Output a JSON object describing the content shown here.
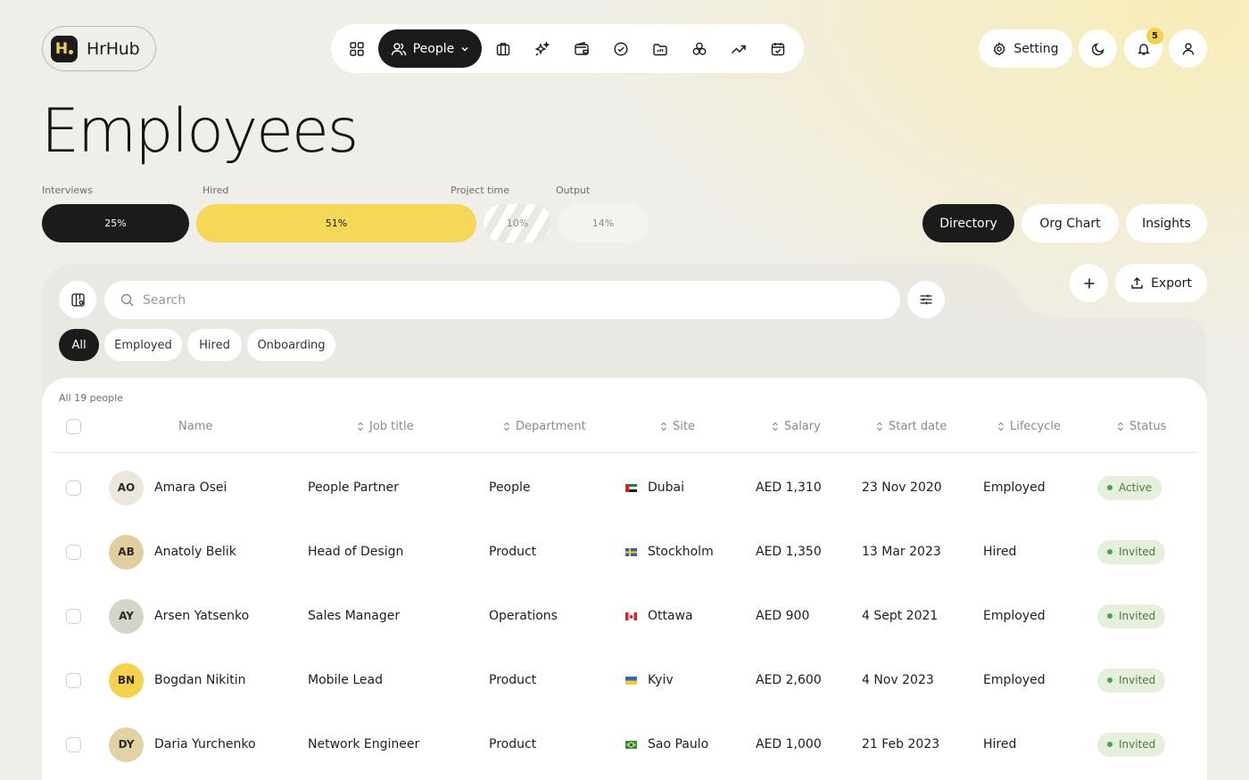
{
  "app": {
    "name": "HrHub",
    "logo_letter": "H"
  },
  "nav": {
    "active_label": "People",
    "icons": [
      "grid-icon",
      "people-icon",
      "briefcase-icon",
      "sparkles-icon",
      "wallet-icon",
      "check-circle-icon",
      "folder-icon",
      "network-icon",
      "trend-icon",
      "calendar-icon"
    ]
  },
  "header": {
    "setting_label": "Setting",
    "notification_count": "5"
  },
  "page": {
    "title": "Employees"
  },
  "metrics": [
    {
      "label": "Interviews",
      "value": "25%"
    },
    {
      "label": "Hired",
      "value": "51%"
    },
    {
      "label": "Project time",
      "value": "10%"
    },
    {
      "label": "Output",
      "value": "14%"
    }
  ],
  "views": [
    "Directory",
    "Org Chart",
    "Insights"
  ],
  "actions": {
    "export_label": "Export"
  },
  "search": {
    "placeholder": "Search"
  },
  "filters": [
    "All",
    "Employed",
    "Hired",
    "Onboarding"
  ],
  "table": {
    "count_label": "All 19 people",
    "columns": [
      "Name",
      "Job title",
      "Department",
      "Site",
      "Salary",
      "Start date",
      "Lifecycle",
      "Status"
    ],
    "rows": [
      {
        "initials": "AO",
        "name": "Amara Osei",
        "job": "People Partner",
        "dept": "People",
        "site": "Dubai",
        "salary": "AED 1,310",
        "start": "23 Nov 2020",
        "lifecycle": "Employed",
        "status": "Active"
      },
      {
        "initials": "AB",
        "name": "Anatoly Belik",
        "job": "Head of Design",
        "dept": "Product",
        "site": "Stockholm",
        "salary": "AED 1,350",
        "start": "13 Mar 2023",
        "lifecycle": "Hired",
        "status": "Invited"
      },
      {
        "initials": "AY",
        "name": "Arsen Yatsenko",
        "job": "Sales Manager",
        "dept": "Operations",
        "site": "Ottawa",
        "salary": "AED 900",
        "start": "4 Sept 2021",
        "lifecycle": "Employed",
        "status": "Invited"
      },
      {
        "initials": "BN",
        "name": "Bogdan Nikitin",
        "job": "Mobile Lead",
        "dept": "Product",
        "site": "Kyiv",
        "salary": "AED 2,600",
        "start": "4 Nov 2023",
        "lifecycle": "Employed",
        "status": "Invited"
      },
      {
        "initials": "DY",
        "name": "Daria Yurchenko",
        "job": "Network Engineer",
        "dept": "Product",
        "site": "Sao Paulo",
        "salary": "AED 1,000",
        "start": "21 Feb 2023",
        "lifecycle": "Hired",
        "status": "Invited"
      }
    ]
  },
  "colors": {
    "accent": "#f5d24e",
    "dark": "#1b1b1b",
    "status_green": "#4ea049"
  }
}
